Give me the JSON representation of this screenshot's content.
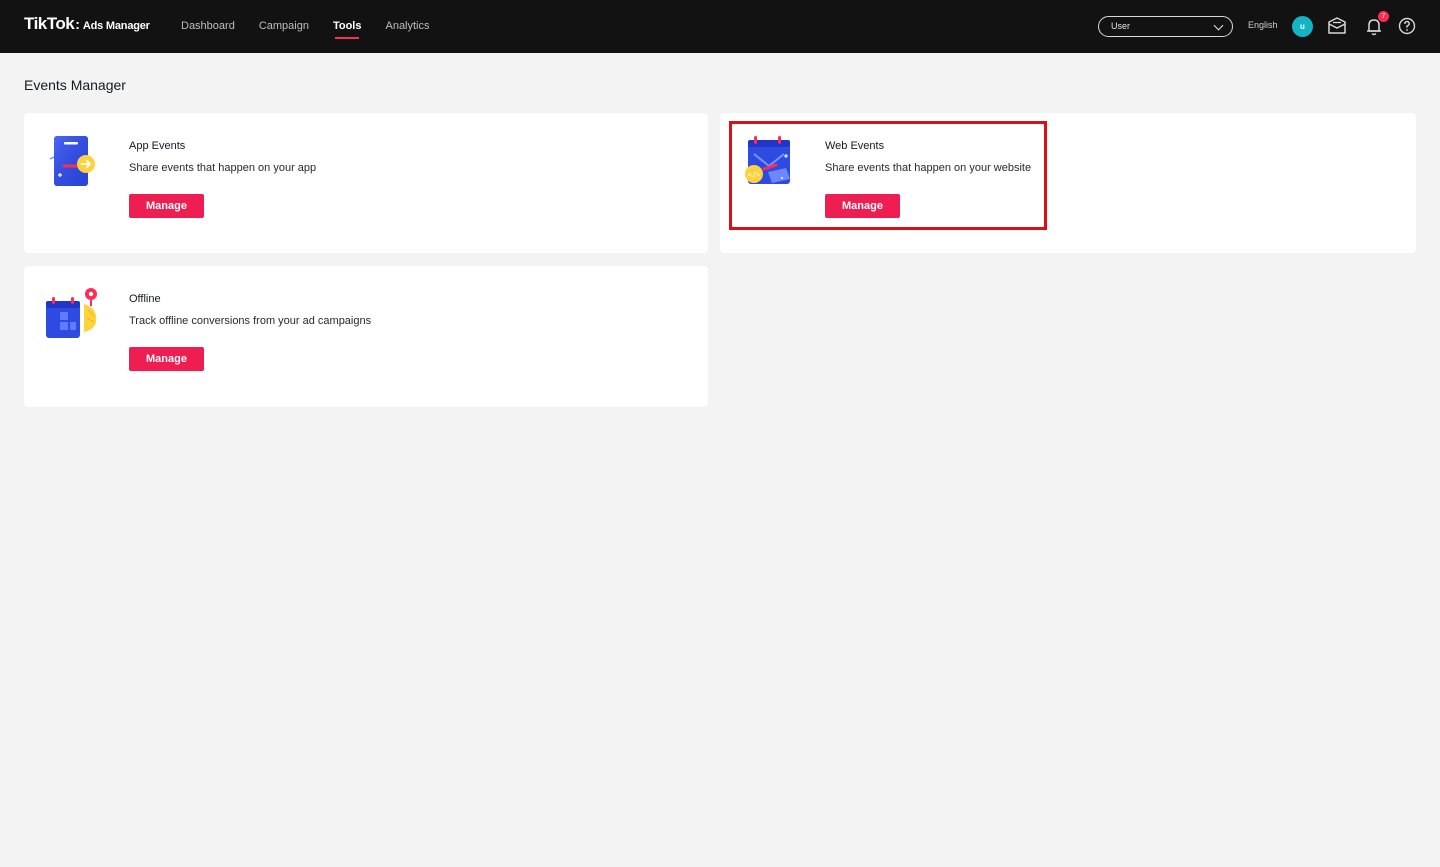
{
  "header": {
    "logo_brand": "TikTok",
    "logo_sep": ":",
    "logo_product": "Ads Manager",
    "nav": [
      {
        "label": "Dashboard",
        "active": false
      },
      {
        "label": "Campaign",
        "active": false
      },
      {
        "label": "Tools",
        "active": true
      },
      {
        "label": "Analytics",
        "active": false
      }
    ],
    "user_select_value": "User",
    "language": "English",
    "avatar_initial": "u",
    "notification_count": "7"
  },
  "page": {
    "title": "Events Manager"
  },
  "cards": [
    {
      "title": "App Events",
      "description": "Share events that happen on your app",
      "button": "Manage",
      "icon": "app-events-illustration"
    },
    {
      "title": "Web Events",
      "description": "Share events that happen on your website",
      "button": "Manage",
      "icon": "web-events-illustration",
      "highlighted": true
    },
    {
      "title": "Offline",
      "description": "Track offline conversions from your ad campaigns",
      "button": "Manage",
      "icon": "offline-illustration"
    }
  ],
  "colors": {
    "topbar": "#121212",
    "accent": "#ee1d52",
    "highlight": "#dd0f13",
    "avatar": "#13b5c4",
    "background": "#f3f3f3"
  }
}
